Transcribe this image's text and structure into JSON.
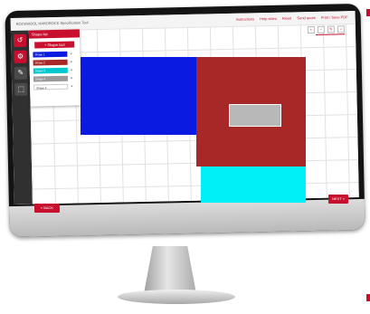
{
  "window": {
    "title": "ROCKWOOL HARDROCK Specification Tool"
  },
  "top_links": [
    "Instructions",
    "Help video",
    "Reset",
    "Send quote",
    "Print / Save PDF"
  ],
  "panel": {
    "header": "Shape list",
    "add_button": "+ Shape tool",
    "layers": [
      {
        "label": "Shape 1",
        "color": "#0a1ae0"
      },
      {
        "label": "Shape 2",
        "color": "#a82828"
      },
      {
        "label": "Shape 3",
        "color": "#00c8d0"
      },
      {
        "label": "Shape 4",
        "color": "#9a9a9a"
      },
      {
        "label": "Shape 5",
        "color": "#ffffff"
      }
    ]
  },
  "tools": [
    "undo-icon",
    "gear-icon",
    "pencil-icon",
    "selection-icon"
  ],
  "mini_toolbar": [
    "zoom-in-icon",
    "zoom-out-icon",
    "pencil-icon",
    "search-icon"
  ],
  "buttons": {
    "back": "« BACK",
    "next": "NEXT »"
  },
  "colors": {
    "accent": "#c8102e",
    "blue_shape": "#0a1ae0",
    "red_shape": "#a82828",
    "cyan_shape": "#00f0f8",
    "grey_shape": "#b8b8b8"
  }
}
